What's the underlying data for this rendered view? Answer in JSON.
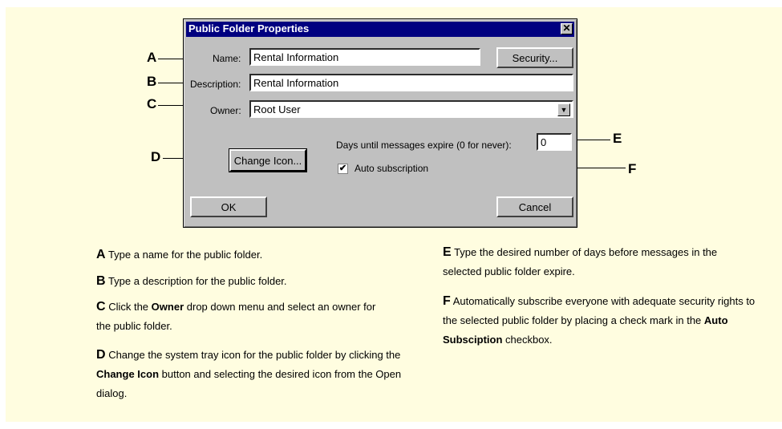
{
  "dialog": {
    "title": "Public Folder Properties",
    "close_glyph": "✕",
    "name_label": "Name:",
    "name_value": "Rental Information",
    "security_button": "Security...",
    "description_label": "Description:",
    "description_value": "Rental Information",
    "owner_label": "Owner:",
    "owner_value": "Root User",
    "dropdown_glyph": "▼",
    "days_label": "Days until messages expire (0 for never):",
    "days_value": "0",
    "change_icon_button": "Change Icon...",
    "auto_sub_label": "Auto subscription",
    "auto_sub_checked": true,
    "check_glyph": "✔",
    "ok_button": "OK",
    "cancel_button": "Cancel"
  },
  "callouts": {
    "a": "A",
    "b": "B",
    "c": "C",
    "d": "D",
    "e": "E",
    "f": "F"
  },
  "descriptions": {
    "a_letter": "A",
    "a_text": "Type a name for the public folder.",
    "b_letter": "B",
    "b_text": "Type a description for the public folder.",
    "c_letter": "C",
    "c_pre": "Click the",
    "c_bold": "Owner",
    "c_post": "drop down menu and select an owner for the public folder.",
    "d_letter": "D",
    "d_pre": "Change the system tray icon for the public folder by clicking the",
    "d_bold": "Change Icon",
    "d_post": "button and selecting the desired icon from the Open dialog.",
    "e_letter": "E",
    "e_text": "Type the desired number of days before messages in the selected public folder expire.",
    "f_letter": "F",
    "f_pre": "Automatically subscribe everyone with adequate security rights to the selected public folder by placing a check mark in the",
    "f_bold": "Auto Subsciption",
    "f_post": "checkbox."
  },
  "colors": {
    "panel": "#fffde0",
    "dialog": "#c0c0c0",
    "titlebar": "#000080"
  }
}
